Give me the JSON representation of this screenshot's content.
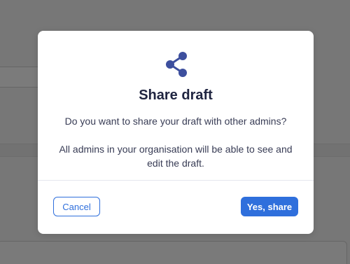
{
  "dialog": {
    "icon": "share-icon",
    "title": "Share draft",
    "question": "Do you want to share your draft with other admins?",
    "info": "All admins in your organisation will be able to see and edit the draft.",
    "cancel_label": "Cancel",
    "confirm_label": "Yes, share"
  },
  "colors": {
    "overlay": "#777777",
    "primary": "#2f6fdc",
    "icon": "#3d4f9e",
    "title": "#1f2440",
    "body_text": "#383c55"
  }
}
